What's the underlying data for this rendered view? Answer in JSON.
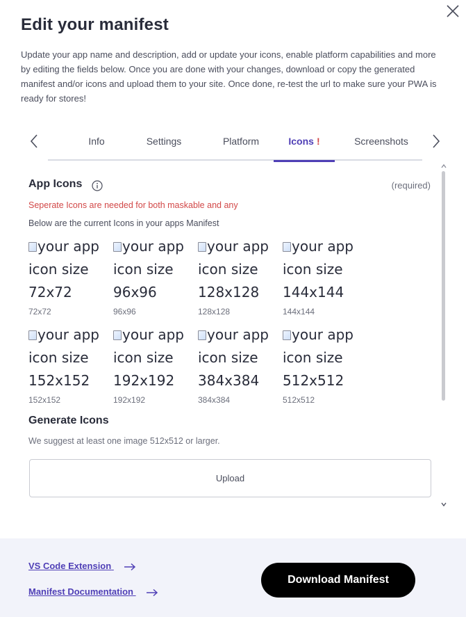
{
  "dialog": {
    "title": "Edit your manifest",
    "intro": "Update your app name and description, add or update your icons, enable platform capabilities and more by editing the fields below. Once you are done with your changes, download or copy the generated manifest and/or icons and upload them to your site. Once done, re-test the url to make sure your PWA is ready for stores!"
  },
  "tabs": [
    {
      "label": "Info",
      "active": false
    },
    {
      "label": "Settings",
      "active": false
    },
    {
      "label": "Platform",
      "active": false
    },
    {
      "label": "Icons",
      "active": true,
      "alert": "!"
    },
    {
      "label": "Screenshots",
      "active": false
    }
  ],
  "app_icons": {
    "title": "App Icons",
    "required_label": "(required)",
    "error": "Seperate Icons are needed for both maskable and any",
    "note": "Below are the current Icons in your apps Manifest",
    "icons": [
      {
        "alt": "your app icon size 72x72",
        "size": "72x72"
      },
      {
        "alt": "your app icon size 96x96",
        "size": "96x96"
      },
      {
        "alt": "your app icon size 128x128",
        "size": "128x128"
      },
      {
        "alt": "your app icon size 144x144",
        "size": "144x144"
      },
      {
        "alt": "your app icon size 152x152",
        "size": "152x152"
      },
      {
        "alt": "your app icon size 192x192",
        "size": "192x192"
      },
      {
        "alt": "your app icon size 384x384",
        "size": "384x384"
      },
      {
        "alt": "your app icon size 512x512",
        "size": "512x512"
      }
    ]
  },
  "generate": {
    "title": "Generate Icons",
    "note": "We suggest at least one image 512x512 or larger.",
    "upload_label": "Upload"
  },
  "footer": {
    "link1": "VS Code Extension",
    "link2": "Manifest Documentation",
    "download_label": "Download Manifest"
  },
  "colors": {
    "accent": "#4f3fb6",
    "error": "#d24848",
    "footer_bg": "#f2f3fa",
    "button_bg": "#000000"
  },
  "icons_used": [
    "close-icon",
    "chevron-left-icon",
    "chevron-right-icon",
    "info-icon",
    "arrow-right-icon",
    "chevron-up-icon",
    "chevron-down-icon",
    "broken-image-icon"
  ]
}
